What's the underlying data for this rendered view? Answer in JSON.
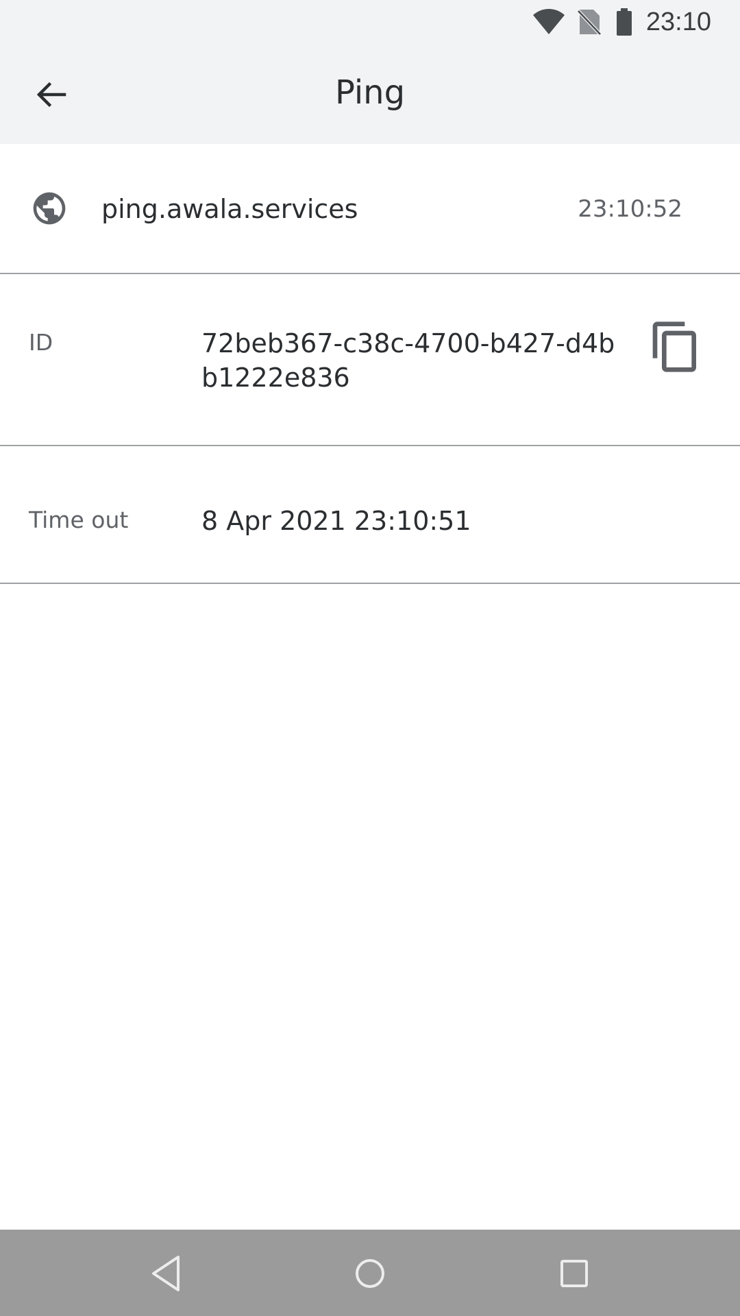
{
  "status_bar": {
    "time": "23:10",
    "icons": [
      "wifi-icon",
      "no-sim-icon",
      "battery-icon"
    ]
  },
  "app_bar": {
    "title": "Ping",
    "back_icon": "arrow-back-icon"
  },
  "ping": {
    "host": "ping.awala.services",
    "time": "23:10:52",
    "host_icon": "globe-icon"
  },
  "details": {
    "id_label": "ID",
    "id_value": "72beb367-c38c-4700-b427-d4bb1222e836",
    "copy_icon": "copy-icon",
    "timeout_label": "Time out",
    "timeout_value": "8 Apr 2021 23:10:51"
  },
  "nav_bar": {
    "icons": [
      "nav-back-icon",
      "nav-home-icon",
      "nav-recents-icon"
    ]
  },
  "colors": {
    "header_bg": "#f2f3f4",
    "nav_bg": "#9b9b9b",
    "divider": "#9ea1a4",
    "text_primary": "#2b2e31",
    "text_secondary": "#5f6266"
  }
}
